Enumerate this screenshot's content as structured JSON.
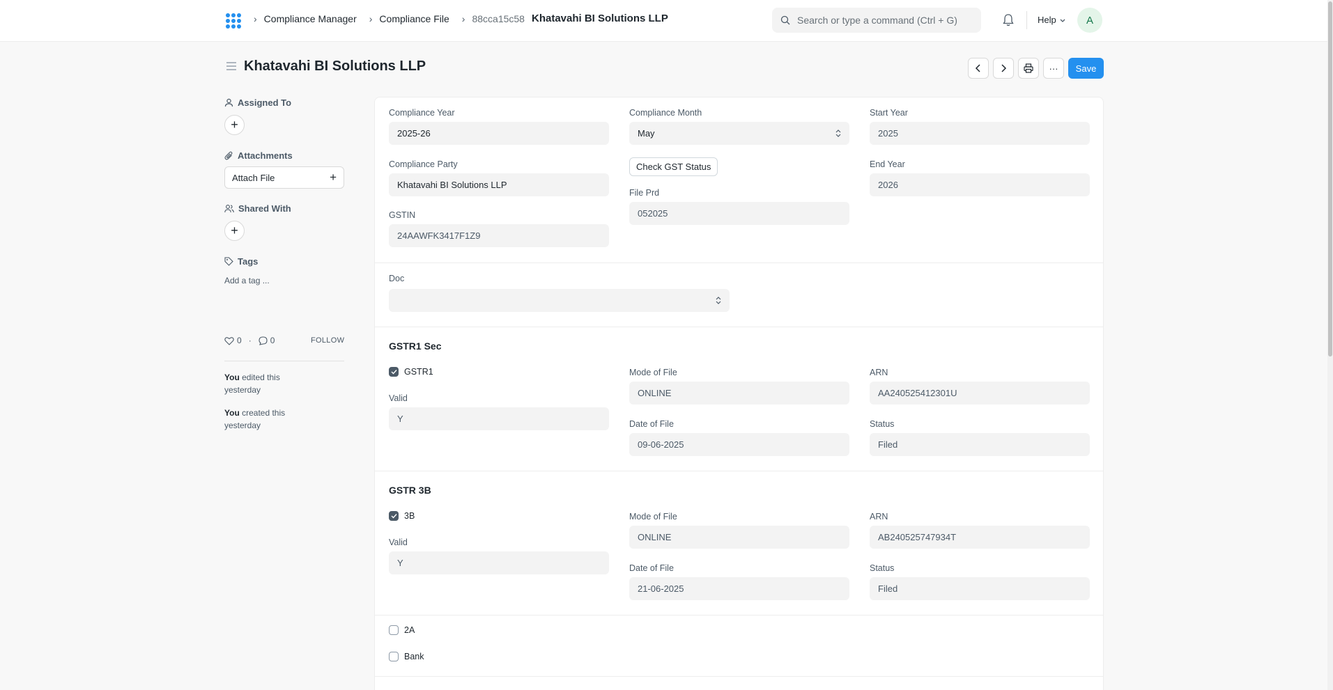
{
  "navbar": {
    "breadcrumbs": [
      "Compliance Manager",
      "Compliance File"
    ],
    "doc_hash": "88cca15c58",
    "doc_name": "Khatavahi BI Solutions LLP",
    "search_placeholder": "Search or type a command (Ctrl + G)",
    "help_label": "Help",
    "avatar_initial": "A"
  },
  "page": {
    "title": "Khatavahi BI Solutions LLP",
    "save_label": "Save",
    "more_label": "···"
  },
  "sidebar": {
    "assigned_to": "Assigned To",
    "attachments": "Attachments",
    "attach_file": "Attach File",
    "shared_with": "Shared With",
    "tags": "Tags",
    "add_tag": "Add a tag ...",
    "likes": "0",
    "comments": "0",
    "dot": "·",
    "follow": "FOLLOW",
    "activity": [
      {
        "who": "You",
        "text": " edited this yesterday"
      },
      {
        "who": "You",
        "text": " created this yesterday"
      }
    ]
  },
  "form": {
    "compliance_year_label": "Compliance Year",
    "compliance_year": "2025-26",
    "compliance_month_label": "Compliance Month",
    "compliance_month": "May",
    "start_year_label": "Start Year",
    "start_year": "2025",
    "compliance_party_label": "Compliance Party",
    "compliance_party": "Khatavahi BI Solutions LLP",
    "check_gst_label": "Check GST Status",
    "end_year_label": "End Year",
    "end_year": "2026",
    "file_prd_label": "File Prd",
    "file_prd": "052025",
    "gstin_label": "GSTIN",
    "gstin": "24AAWFK3417F1Z9",
    "doc_label": "Doc",
    "doc_value": ""
  },
  "gstr1": {
    "title": "GSTR1 Sec",
    "check_label": "GSTR1",
    "checked": true,
    "valid_label": "Valid",
    "valid": "Y",
    "mode_label": "Mode of File",
    "mode": "ONLINE",
    "date_label": "Date of File",
    "date": "09-06-2025",
    "arn_label": "ARN",
    "arn": "AA240525412301U",
    "status_label": "Status",
    "status": "Filed"
  },
  "gstr3b": {
    "title": "GSTR 3B",
    "check_label": "3B",
    "checked": true,
    "valid_label": "Valid",
    "valid": "Y",
    "mode_label": "Mode of File",
    "mode": "ONLINE",
    "date_label": "Date of File",
    "date": "21-06-2025",
    "arn_label": "ARN",
    "arn": "AB240525747934T",
    "status_label": "Status",
    "status": "Filed"
  },
  "extra": {
    "check_2a": "2A",
    "check_bank": "Bank"
  },
  "colors": {
    "accent": "#2490ef",
    "logo": "#2490ef"
  },
  "icons": [
    "app-logo-icon",
    "chevron-right-icon",
    "search-icon",
    "bell-icon",
    "chevron-down-icon",
    "hamburger-icon",
    "chevron-left-icon",
    "printer-icon",
    "user-icon",
    "paperclip-icon",
    "users-icon",
    "tag-icon",
    "heart-icon",
    "comment-icon",
    "select-arrows-icon",
    "check-icon"
  ]
}
